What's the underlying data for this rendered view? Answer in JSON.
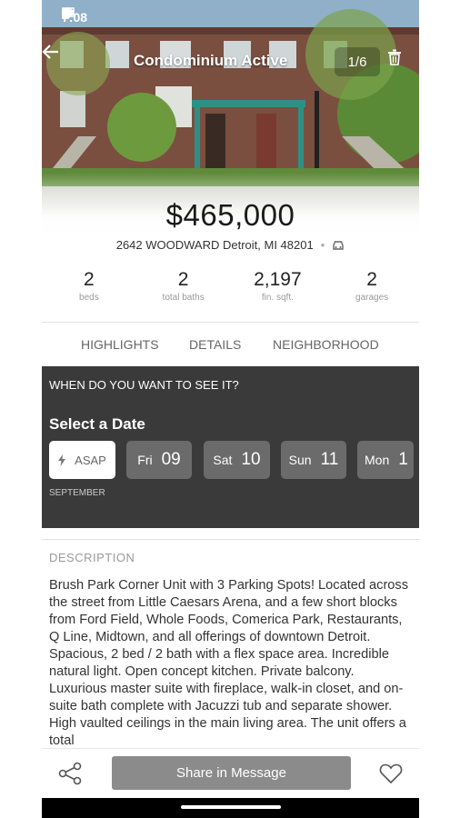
{
  "status_bar": {
    "time": "7:08",
    "icons": [
      "settings-icon",
      "record-icon",
      "android-icon",
      "circle-icon",
      "dot-icon"
    ],
    "right_icons": [
      "cast-icon",
      "link-icon",
      "wifi-icon",
      "battery-icon"
    ]
  },
  "header": {
    "title": "Condominium Active",
    "photo_counter": "1/6"
  },
  "listing": {
    "price": "$465,000",
    "address": "2642 WOODWARD Detroit, MI 48201",
    "separator": "•",
    "stats": [
      {
        "value": "2",
        "label": "beds"
      },
      {
        "value": "2",
        "label": "total baths"
      },
      {
        "value": "2,197",
        "label": "fin. sqft."
      },
      {
        "value": "2",
        "label": "garages"
      }
    ]
  },
  "tabs": [
    "HIGHLIGHTS",
    "DETAILS",
    "NEIGHBORHOOD"
  ],
  "schedule": {
    "question": "WHEN DO YOU WANT TO SEE IT?",
    "select_label": "Select a Date",
    "asap_label": "ASAP",
    "dates": [
      {
        "day": "Fri",
        "date": "09"
      },
      {
        "day": "Sat",
        "date": "10"
      },
      {
        "day": "Sun",
        "date": "11"
      },
      {
        "day": "Mon",
        "date": "1"
      }
    ],
    "month": "SEPTEMBER"
  },
  "description": {
    "label": "DESCRIPTION",
    "text": "Brush Park Corner Unit with 3 Parking Spots! Located across the street from Little Caesars Arena, and a few short blocks from Ford Field, Whole Foods, Comerica Park, Restaurants, Q Line, Midtown, and all offerings of downtown Detroit. Spacious, 2 bed / 2 bath with a flex space area. Incredible natural light. Open concept kitchen. Private balcony. Luxurious master suite with fireplace, walk-in closet, and on-suite bath complete with Jacuzzi tub and separate shower. High vaulted ceilings in the main living area. The unit offers a total"
  },
  "bottom_bar": {
    "share_message_label": "Share in Message"
  },
  "colors": {
    "schedule_bg": "#3a3a3a",
    "chip_bg": "#6b6b6b",
    "share_btn_bg": "#8b8b8b"
  }
}
